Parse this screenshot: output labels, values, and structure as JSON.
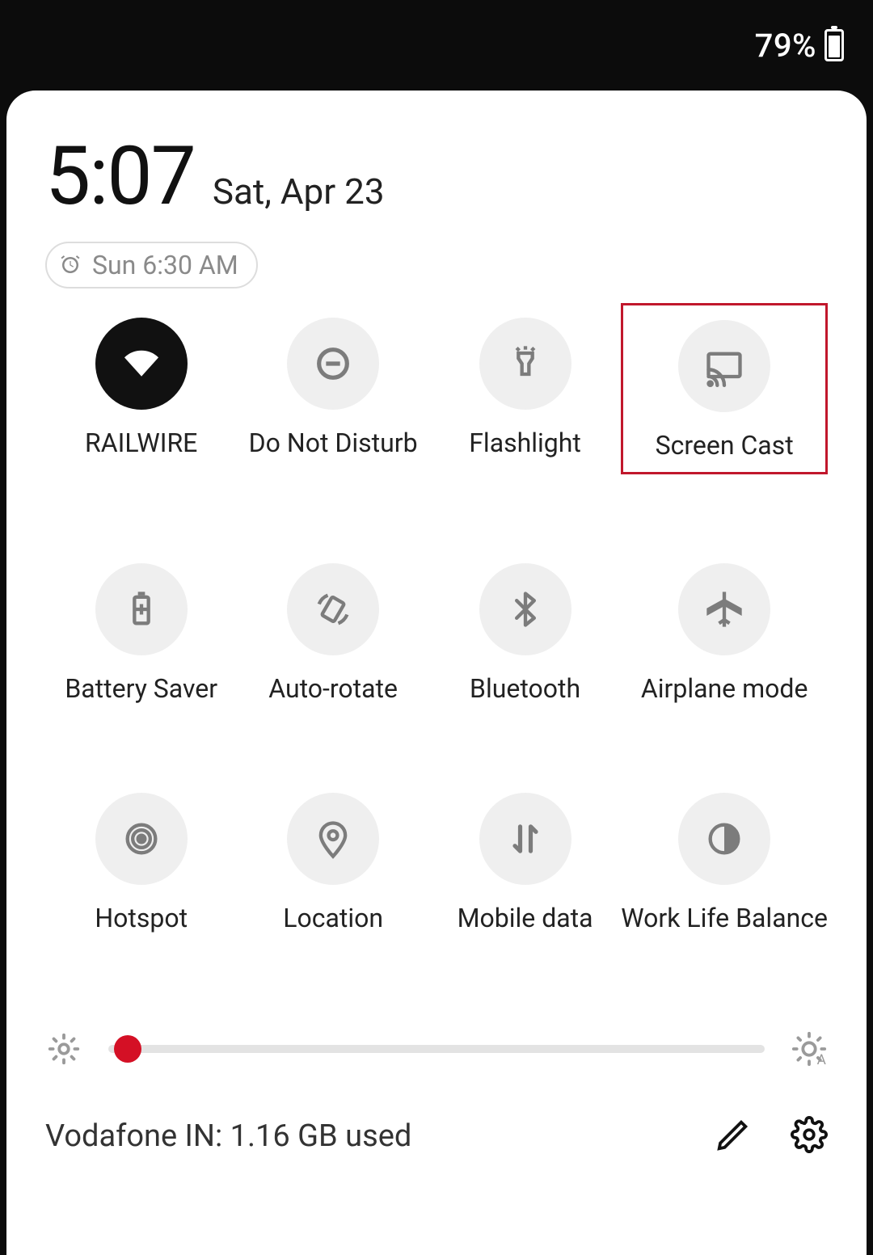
{
  "status": {
    "battery_percent": "79%"
  },
  "header": {
    "time": "5:07",
    "date": "Sat, Apr 23",
    "alarm": "Sun 6:30 AM"
  },
  "tiles": [
    {
      "id": "wifi",
      "label": "RAILWIRE",
      "active": true,
      "icon": "wifi-icon"
    },
    {
      "id": "dnd",
      "label": "Do Not Disturb",
      "active": false,
      "icon": "dnd-icon"
    },
    {
      "id": "flashlight",
      "label": "Flashlight",
      "active": false,
      "icon": "flashlight-icon"
    },
    {
      "id": "screencast",
      "label": "Screen Cast",
      "active": false,
      "icon": "cast-icon",
      "highlighted": true
    },
    {
      "id": "batterysaver",
      "label": "Battery Saver",
      "active": false,
      "icon": "battery-saver-icon"
    },
    {
      "id": "autorotate",
      "label": "Auto-rotate",
      "active": false,
      "icon": "auto-rotate-icon"
    },
    {
      "id": "bluetooth",
      "label": "Bluetooth",
      "active": false,
      "icon": "bluetooth-icon"
    },
    {
      "id": "airplane",
      "label": "Airplane mode",
      "active": false,
      "icon": "airplane-icon"
    },
    {
      "id": "hotspot",
      "label": "Hotspot",
      "active": false,
      "icon": "hotspot-icon"
    },
    {
      "id": "location",
      "label": "Location",
      "active": false,
      "icon": "location-icon"
    },
    {
      "id": "mobiledata",
      "label": "Mobile data",
      "active": false,
      "icon": "mobile-data-icon"
    },
    {
      "id": "worklife",
      "label": "Work Life Balance",
      "active": false,
      "icon": "work-life-icon"
    }
  ],
  "brightness": {
    "percent": 3
  },
  "footer": {
    "data_usage": "Vodafone IN: 1.16 GB used"
  },
  "colors": {
    "accent": "#d41025",
    "highlight_border": "#c1172c",
    "tile_inactive_bg": "#efefef",
    "tile_active_bg": "#111111"
  }
}
